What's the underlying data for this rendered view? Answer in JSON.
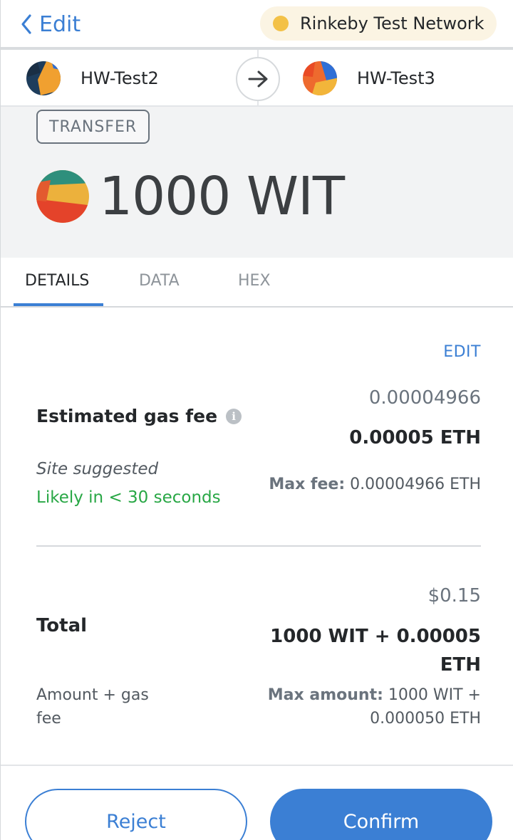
{
  "header": {
    "back_label": "Edit",
    "network_label": "Rinkeby Test Network"
  },
  "accounts": {
    "from_name": "HW-Test2",
    "to_name": "HW-Test3"
  },
  "summary": {
    "action_badge": "TRANSFER",
    "amount": "1000 WIT"
  },
  "tabs": [
    {
      "label": "DETAILS",
      "active": true
    },
    {
      "label": "DATA",
      "active": false
    },
    {
      "label": "HEX",
      "active": false
    }
  ],
  "gas": {
    "edit_label": "EDIT",
    "title": "Estimated gas fee",
    "secondary_value": "0.00004966",
    "primary_value": "0.00005 ETH",
    "site_suggested": "Site suggested",
    "likely_label": "Likely in < 30 seconds",
    "max_fee_label": "Max fee:",
    "max_fee_value": "0.00004966 ETH"
  },
  "total": {
    "title": "Total",
    "fiat": "$0.15",
    "main_line1": "1000 WIT + 0.00005",
    "main_line2": "ETH",
    "subtitle": "Amount + gas fee",
    "max_amount_label": "Max amount:",
    "max_amount_value": "1000 WIT + 0.000050 ETH"
  },
  "footer": {
    "reject_label": "Reject",
    "confirm_label": "Confirm"
  },
  "colors": {
    "accent": "#3b7fd4",
    "success": "#28a745",
    "network_dot": "#f3c147"
  }
}
